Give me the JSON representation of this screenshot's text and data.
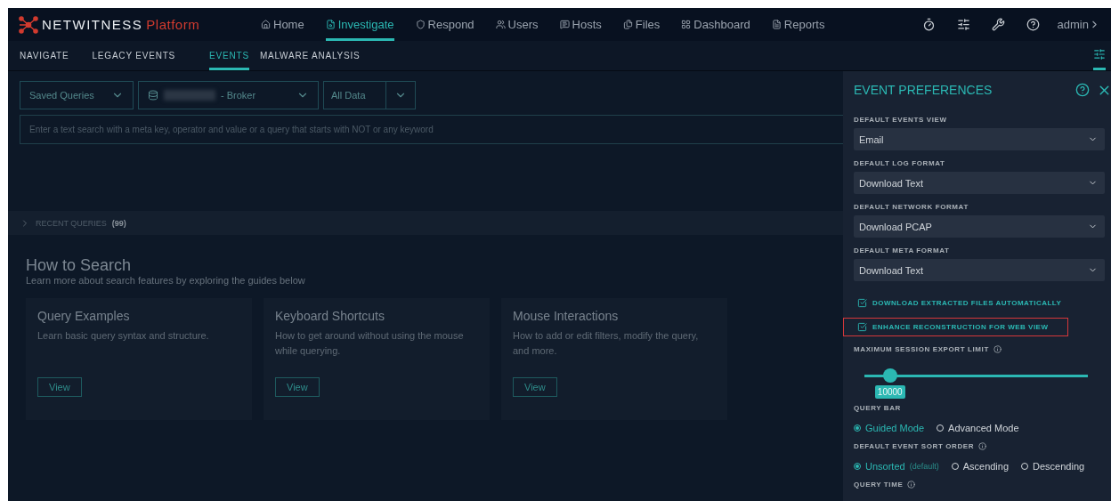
{
  "logo": {
    "name": "NETWITNESS",
    "product": "Platform"
  },
  "nav": [
    {
      "label": "Home",
      "selected": false
    },
    {
      "label": "Investigate",
      "selected": true
    },
    {
      "label": "Respond",
      "selected": false
    },
    {
      "label": "Users",
      "selected": false
    },
    {
      "label": "Hosts",
      "selected": false
    },
    {
      "label": "Files",
      "selected": false
    },
    {
      "label": "Dashboard",
      "selected": false
    },
    {
      "label": "Reports",
      "selected": false
    }
  ],
  "user": {
    "name": "admin"
  },
  "subnav": [
    {
      "label": "NAVIGATE",
      "selected": false
    },
    {
      "label": "LEGACY EVENTS",
      "selected": false
    },
    {
      "label": "EVENTS",
      "selected": true
    },
    {
      "label": "MALWARE ANALYSIS",
      "selected": false
    }
  ],
  "filters": {
    "saved_queries": "Saved Queries",
    "service": "- Broker",
    "time_range": "All Data"
  },
  "search": {
    "placeholder": "Enter a text search with a meta key, operator and value or a query that starts with NOT or any keyword"
  },
  "recent_queries": {
    "label": "RECENT QUERIES",
    "count": "(99)",
    "expanded": false
  },
  "how_to": {
    "title": "How to Search",
    "subtitle": "Learn more about search features by exploring the guides below",
    "cards": [
      {
        "title": "Query Examples",
        "text": "Learn basic query syntax and structure.",
        "button": "View"
      },
      {
        "title": "Keyboard Shortcuts",
        "text": "How to get around without using the mouse while querying.",
        "button": "View"
      },
      {
        "title": "Mouse Interactions",
        "text": "How to add or edit filters, modify the query, and more.",
        "button": "View"
      }
    ]
  },
  "preferences": {
    "title": "EVENT PREFERENCES",
    "selects": [
      {
        "label": "DEFAULT EVENTS VIEW",
        "value": "Email"
      },
      {
        "label": "DEFAULT LOG FORMAT",
        "value": "Download Text"
      },
      {
        "label": "DEFAULT NETWORK FORMAT",
        "value": "Download PCAP"
      },
      {
        "label": "DEFAULT META FORMAT",
        "value": "Download Text"
      }
    ],
    "checkboxes": [
      {
        "label": "DOWNLOAD EXTRACTED FILES AUTOMATICALLY",
        "checked": true,
        "highlighted": false
      },
      {
        "label": "ENHANCE RECONSTRUCTION FOR WEB VIEW",
        "checked": true,
        "highlighted": true
      }
    ],
    "export_limit": {
      "label": "MAXIMUM SESSION EXPORT LIMIT",
      "level": 0.115,
      "value": "10000"
    },
    "query_bar": {
      "label": "QUERY BAR",
      "options": [
        {
          "label": "Guided Mode",
          "selected": true
        },
        {
          "label": "Advanced Mode",
          "selected": false
        }
      ]
    },
    "sort_order": {
      "label": "DEFAULT EVENT SORT ORDER",
      "options": [
        {
          "label": "Unsorted",
          "note": "(default)",
          "selected": true
        },
        {
          "label": "Ascending",
          "selected": false
        },
        {
          "label": "Descending",
          "selected": false
        }
      ]
    },
    "query_time": {
      "label": "QUERY TIME"
    }
  }
}
